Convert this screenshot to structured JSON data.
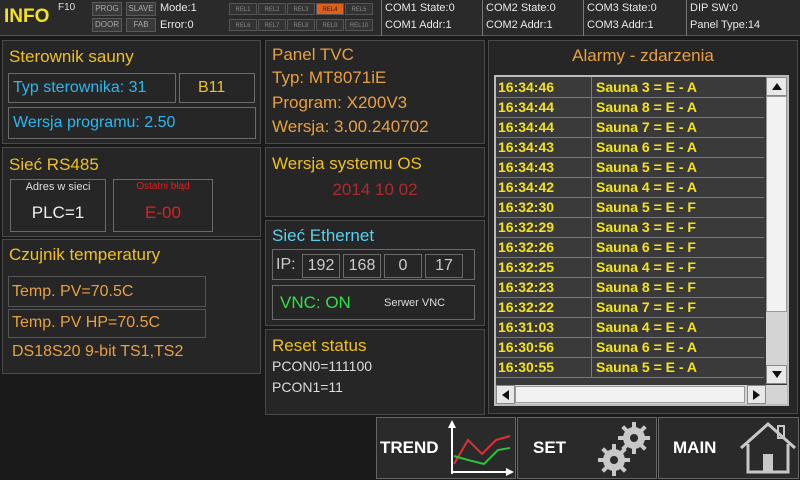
{
  "topbar": {
    "info": "INFO",
    "fkey": "F10",
    "prog": "PROG",
    "slave": "SLAVE",
    "door": "DOOR",
    "fab": "FAB",
    "mode": "Mode:1",
    "error": "Error:0",
    "rel_top": [
      "REL1",
      "REL2",
      "REL3",
      "REL4",
      "REL5"
    ],
    "rel_bottom": [
      "REL6",
      "REL7",
      "REL8",
      "REL9",
      "REL10"
    ],
    "com1_state": "COM1 State:0",
    "com1_addr": "COM1 Addr:1",
    "com2_state": "COM2 State:0",
    "com2_addr": "COM2 Addr:1",
    "com3_state": "COM3 State:0",
    "com3_addr": "COM3 Addr:1",
    "dip": "DIP SW:0",
    "panel_type": "Panel Type:14",
    "active_color": "#e0601a"
  },
  "controller": {
    "title": "Sterownik sauny",
    "type_label": "Typ sterownika: 31",
    "type_code": "B11",
    "version": "Wersja programu: 2.50"
  },
  "rs485": {
    "title": "Sieć RS485",
    "addr_label": "Adres w sieci",
    "addr_value": "PLC=1",
    "err_label": "Ostatni błąd",
    "err_value": "E-00"
  },
  "sensor": {
    "title": "Czujnik temperatury",
    "pv": "Temp. PV=70.5C",
    "pv_hp": "Temp. PV HP=70.5C",
    "type": "DS18S20 9-bit TS1,TS2"
  },
  "panel_tvc": {
    "title": "Panel TVC",
    "type": "Typ: MT8071iE",
    "program": "Program: X200V3",
    "version": "Wersja: 3.00.240702"
  },
  "os": {
    "title": "Wersja systemu OS",
    "value": "2014 10 02"
  },
  "ethernet": {
    "title": "Sieć Ethernet",
    "ip_label": "IP:",
    "ip": [
      "192",
      "168",
      "0",
      "17"
    ],
    "vnc": "VNC: ON",
    "vnc_label": "Serwer VNC"
  },
  "reset": {
    "title": "Reset status",
    "pcon0": "PCON0=111100",
    "pcon1": "PCON1=11"
  },
  "alarms": {
    "title": "Alarmy - zdarzenia",
    "rows": [
      {
        "time": "16:34:46",
        "msg": "Sauna 3 = E - A"
      },
      {
        "time": "16:34:44",
        "msg": "Sauna 8 = E - A"
      },
      {
        "time": "16:34:44",
        "msg": "Sauna 7 = E - A"
      },
      {
        "time": "16:34:43",
        "msg": "Sauna 6 = E - A"
      },
      {
        "time": "16:34:43",
        "msg": "Sauna 5 = E - A"
      },
      {
        "time": "16:34:42",
        "msg": "Sauna 4 = E - A"
      },
      {
        "time": "16:32:30",
        "msg": "Sauna 5 = E - F"
      },
      {
        "time": "16:32:29",
        "msg": "Sauna 3 = E - F"
      },
      {
        "time": "16:32:26",
        "msg": "Sauna 6 = E - F"
      },
      {
        "time": "16:32:25",
        "msg": "Sauna 4 = E - F"
      },
      {
        "time": "16:32:23",
        "msg": "Sauna 8 = E - F"
      },
      {
        "time": "16:32:22",
        "msg": "Sauna 7 = E - F"
      },
      {
        "time": "16:31:03",
        "msg": "Sauna 4 = E - A"
      },
      {
        "time": "16:30:56",
        "msg": "Sauna 6 = E - A"
      },
      {
        "time": "16:30:55",
        "msg": "Sauna 5 = E - A"
      }
    ]
  },
  "nav": {
    "trend": "TREND",
    "set": "SET",
    "main": "MAIN"
  }
}
